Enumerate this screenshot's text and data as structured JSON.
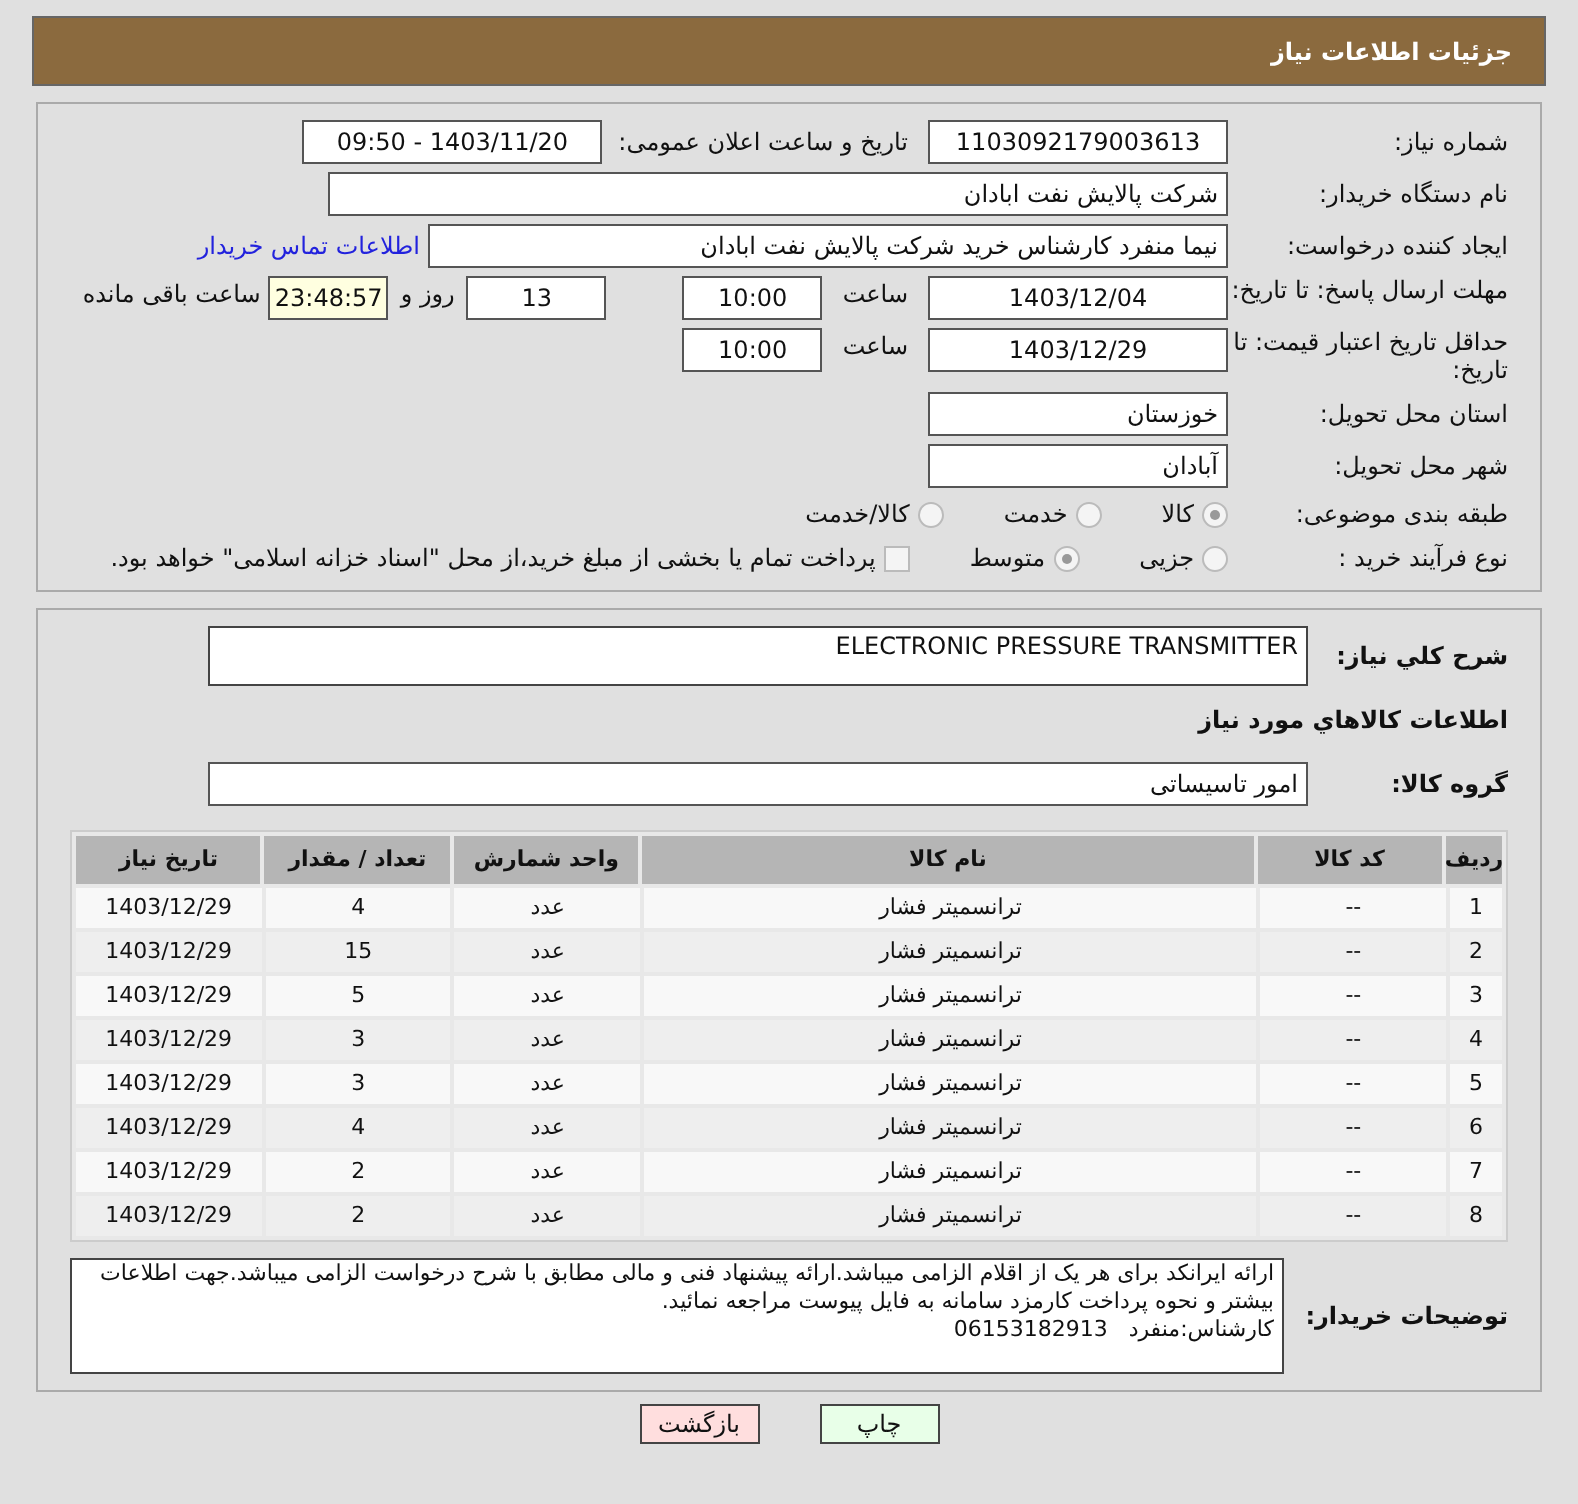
{
  "header": {
    "title": "جزئیات اطلاعات نیاز"
  },
  "details": {
    "need_number": {
      "label": "شماره نیاز:",
      "value": "1103092179003613"
    },
    "announce": {
      "label": "تاریخ و ساعت اعلان عمومی:",
      "value": "1403/11/20 - 09:50"
    },
    "buyer_org": {
      "label": "نام دستگاه خریدار:",
      "value": "شرکت پالایش نفت ابادان"
    },
    "requester": {
      "label": "ایجاد کننده درخواست:",
      "value": "نیما منفرد کارشناس خرید شرکت پالایش نفت ابادان",
      "link": "اطلاعات تماس خریدار"
    },
    "deadline": {
      "label": "مهلت ارسال پاسخ: تا تاریخ:",
      "date": "1403/12/04",
      "time_label": "ساعت",
      "time": "10:00",
      "days": "13",
      "days_label": "روز و",
      "remaining": "23:48:57",
      "remaining_label": "ساعت باقی مانده"
    },
    "validity": {
      "label": "حداقل تاریخ اعتبار قیمت: تا تاریخ:",
      "date": "1403/12/29",
      "time_label": "ساعت",
      "time": "10:00"
    },
    "province": {
      "label": "استان محل تحویل:",
      "value": "خوزستان"
    },
    "city": {
      "label": "شهر محل تحویل:",
      "value": "آبادان"
    },
    "category": {
      "label": "طبقه بندی موضوعی:",
      "options": [
        {
          "label": "کالا",
          "selected": true
        },
        {
          "label": "خدمت",
          "selected": false
        },
        {
          "label": "کالا/خدمت",
          "selected": false
        }
      ]
    },
    "process": {
      "label": "نوع فرآیند خرید :",
      "options": [
        {
          "label": "جزیی",
          "selected": false
        },
        {
          "label": "متوسط",
          "selected": true
        }
      ],
      "payment": {
        "label": "پرداخت تمام یا بخشی از مبلغ خرید،از محل \"اسناد خزانه اسلامی\" خواهد بود.",
        "checked": false
      }
    }
  },
  "goods": {
    "summary": {
      "label": "شرح کلي نياز:",
      "value": "ELECTRONIC PRESSURE TRANSMITTER"
    },
    "section_title": "اطلاعات کالاهاي مورد نياز",
    "group": {
      "label": "گروه کالا:",
      "value": "امور تاسیساتی"
    },
    "table": {
      "columns": [
        "ردیف",
        "کد کالا",
        "نام کالا",
        "واحد شمارش",
        "تعداد / مقدار",
        "تاریخ نیاز"
      ],
      "rows": [
        [
          "1",
          "--",
          "ترانسمیتر فشار",
          "عدد",
          "4",
          "1403/12/29"
        ],
        [
          "2",
          "--",
          "ترانسمیتر فشار",
          "عدد",
          "15",
          "1403/12/29"
        ],
        [
          "3",
          "--",
          "ترانسمیتر فشار",
          "عدد",
          "5",
          "1403/12/29"
        ],
        [
          "4",
          "--",
          "ترانسمیتر فشار",
          "عدد",
          "3",
          "1403/12/29"
        ],
        [
          "5",
          "--",
          "ترانسمیتر فشار",
          "عدد",
          "3",
          "1403/12/29"
        ],
        [
          "6",
          "--",
          "ترانسمیتر فشار",
          "عدد",
          "4",
          "1403/12/29"
        ],
        [
          "7",
          "--",
          "ترانسمیتر فشار",
          "عدد",
          "2",
          "1403/12/29"
        ],
        [
          "8",
          "--",
          "ترانسمیتر فشار",
          "عدد",
          "2",
          "1403/12/29"
        ]
      ]
    },
    "notes": {
      "label": "توضیحات خریدار:",
      "lines": [
        "ارائه ایرانکد برای هر یک از اقلام الزامی میباشد.ارائه پیشنهاد فنی و مالی مطابق با شرح درخواست الزامی میباشد.جهت اطلاعات بیشتر و نحوه پرداخت کارمزد سامانه به فایل پیوست مراجعه نمائید.",
        "کارشناس:منفرد   06153182913"
      ]
    }
  },
  "buttons": [
    {
      "label": "چاپ",
      "kind": "print"
    },
    {
      "label": "بازگشت",
      "kind": "back"
    }
  ]
}
